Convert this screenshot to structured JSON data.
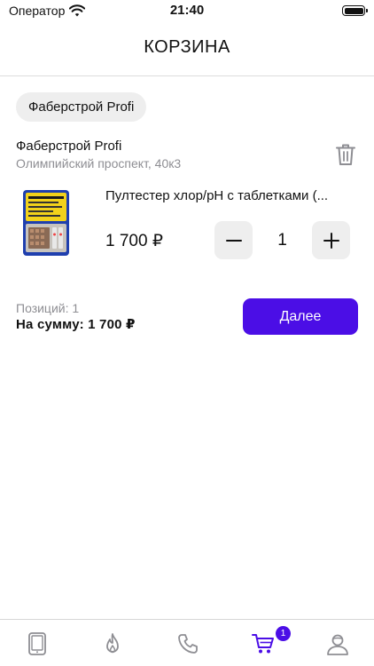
{
  "status_bar": {
    "carrier": "Оператор",
    "time": "21:40",
    "icons": [
      "wifi-icon",
      "battery-icon"
    ]
  },
  "header": {
    "title": "КОРЗИНА"
  },
  "store_chip": "Фаберстрой Profi",
  "store": {
    "name": "Фаберстрой Profi",
    "address": "Олимпийский проспект, 40к3"
  },
  "product": {
    "name": "Пултестер хлор/рН с таблетками (...",
    "price": "1 700 ₽",
    "quantity": "1"
  },
  "summary": {
    "positions": "Позиций: 1",
    "total": "На сумму: 1 700 ₽",
    "next_label": "Далее"
  },
  "tab_bar": {
    "items": [
      "catalog-device-icon",
      "fire-icon",
      "phone-icon",
      "cart-icon",
      "profile-icon"
    ],
    "active": "cart-icon",
    "cart_badge": "1"
  },
  "colors": {
    "accent": "#4b0ee6",
    "inactive_icon": "#8e8e93",
    "chip_bg": "#eeeeee"
  }
}
